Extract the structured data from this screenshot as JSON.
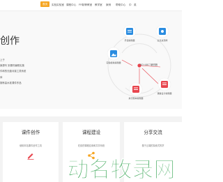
{
  "nav": {
    "items": [
      "首页",
      "实验实验室",
      "课程中心",
      "FR制等教室",
      "教学室",
      "案例",
      "帮助中心",
      "中",
      "英"
    ],
    "active_index": 0
  },
  "hero": {
    "title": "创作",
    "lines": [
      "上于",
      "案源写 到课件编辑实施",
      "件和的无缝对接工具系统",
      "体",
      "拥有高水准课件作品"
    ]
  },
  "diagram": {
    "center_label": "\"5G+ABC\"编辑器",
    "nodes": [
      {
        "label": "手漫编辑器",
        "icon": "sticky-note-icon",
        "color": "#2a8ce0"
      },
      {
        "label": "全息资源库",
        "icon": "puzzle-icon",
        "color": "#2a8ce0"
      },
      {
        "label": "实验模拟编辑器",
        "icon": "picture-icon",
        "color": "#2a8ce0"
      },
      {
        "label": "执行剧本编辑器",
        "icon": "document-icon",
        "color": "#e8454e"
      },
      {
        "label": "课堂设计编辑器",
        "icon": "notebook-icon",
        "color": "#e8454e"
      }
    ],
    "accent": "#e8454e",
    "ring_color": "#e6e6e6"
  },
  "cards": [
    {
      "title": "课件创作",
      "desc": "使用本站课件创作工具",
      "icon": "edit-icon",
      "color": "#e8454e"
    },
    {
      "title": "课程建设",
      "desc": "在线的课程应用和共享系统",
      "icon": "share-icon",
      "color": "#f6a623"
    },
    {
      "title": "分享交流",
      "desc": "基于云端的探索式的学",
      "icon": "",
      "color": "#f6a623"
    }
  ],
  "watermark": {
    "text": "动名牧录网",
    "color": "#1f9a3f"
  }
}
